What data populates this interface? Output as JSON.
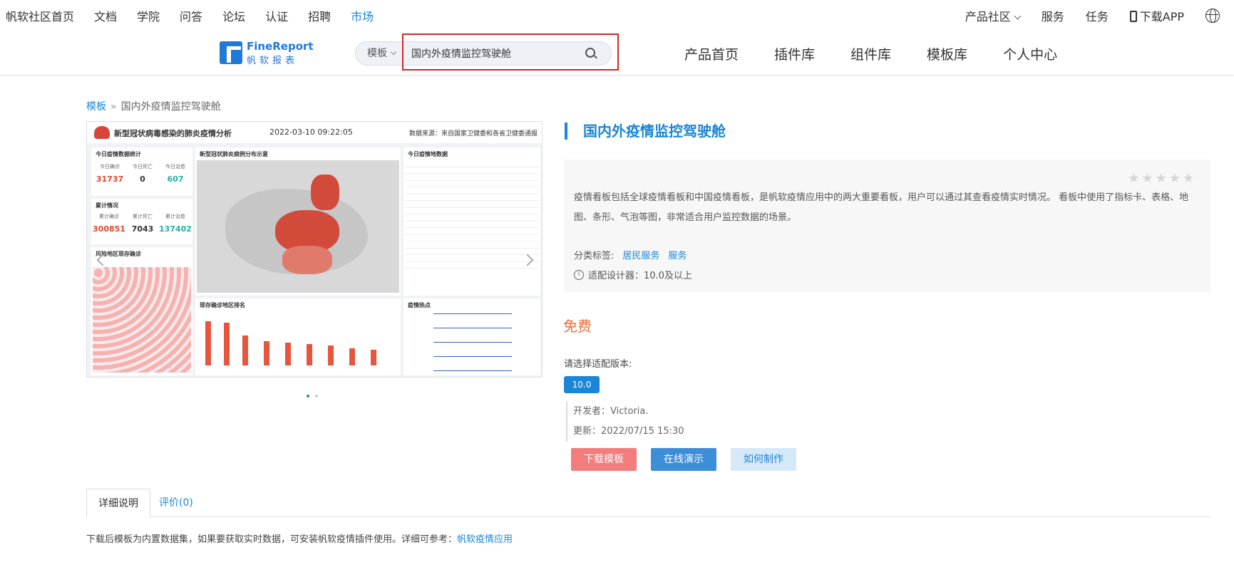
{
  "topnav": {
    "left": [
      "帆软社区首页",
      "文档",
      "学院",
      "问答",
      "论坛",
      "认证",
      "招聘",
      "市场"
    ],
    "active": "市场",
    "right": {
      "product_community": "产品社区",
      "service": "服务",
      "tasks": "任务",
      "download_app": "下载APP"
    }
  },
  "header": {
    "logo_text": "FineReport",
    "logo_sub": "帆软报表",
    "search": {
      "type": "模板",
      "value": "国内外疫情监控驾驶舱",
      "placeholder": ""
    },
    "nav": [
      "产品首页",
      "插件库",
      "组件库",
      "模板库",
      "个人中心"
    ]
  },
  "breadcrumb": {
    "root": "模板",
    "sep": "»",
    "current": "国内外疫情监控驾驶舱"
  },
  "preview": {
    "title": "新型冠状病毒感染的肺炎疫情分析",
    "date": "2022-03-10 09:22:05",
    "source": "数据来源：来自国家卫健委和各省卫健委通报",
    "panels": {
      "today": "今日疫情数据统计",
      "cumulative": "累计情况",
      "risk": "风险地区现存确诊",
      "map": "新型冠状肺炎病例分布示意",
      "table": "今日疫情地数据",
      "ranking": "现存确诊地区排名",
      "news": "疫情热点"
    },
    "kpi_today": [
      {
        "label": "今日确诊",
        "value": "31737",
        "color": "#e0462d"
      },
      {
        "label": "今日死亡",
        "value": "0",
        "color": "#333333"
      },
      {
        "label": "今日治愈",
        "value": "607",
        "color": "#22b29a"
      }
    ],
    "kpi_total": [
      {
        "label": "累计确诊",
        "value": "300851",
        "color": "#e0462d"
      },
      {
        "label": "累计死亡",
        "value": "7043",
        "color": "#333333"
      },
      {
        "label": "累计治愈",
        "value": "137402",
        "color": "#22b29a"
      }
    ]
  },
  "product": {
    "title": "国内外疫情监控驾驶舱",
    "stars": "★★★★★",
    "description": "疫情看板包括全球疫情看板和中国疫情看板，是帆软疫情应用中的两大重要看板，用户可以通过其查看疫情实时情况。 看板中使用了指标卡、表格、地图、条形、气泡等图，非常适合用户监控数据的场景。",
    "tags_label": "分类标签:",
    "tags": [
      "居民服务",
      "服务"
    ],
    "compat": "适配设计器：10.0及以上",
    "price": "免费",
    "version_label": "请选择适配版本:",
    "version": "10.0",
    "developer": "开发者：Victoria.",
    "updated": "更新：2022/07/15 15:30",
    "buttons": {
      "download": "下载模板",
      "demo": "在线演示",
      "howto": "如何制作"
    }
  },
  "tabs": {
    "detail": "详细说明",
    "reviews": "评价(0)"
  },
  "note": {
    "text": "下载后模板为内置数据集，如果要获取实时数据，可安装帆软疫情插件使用。详细可参考：",
    "link": "帆软疫情应用"
  },
  "colors": {
    "accent": "#1b86d6",
    "price": "#f06a3a",
    "download_btn": "#f37c7c",
    "highlight_border": "#d32727"
  }
}
